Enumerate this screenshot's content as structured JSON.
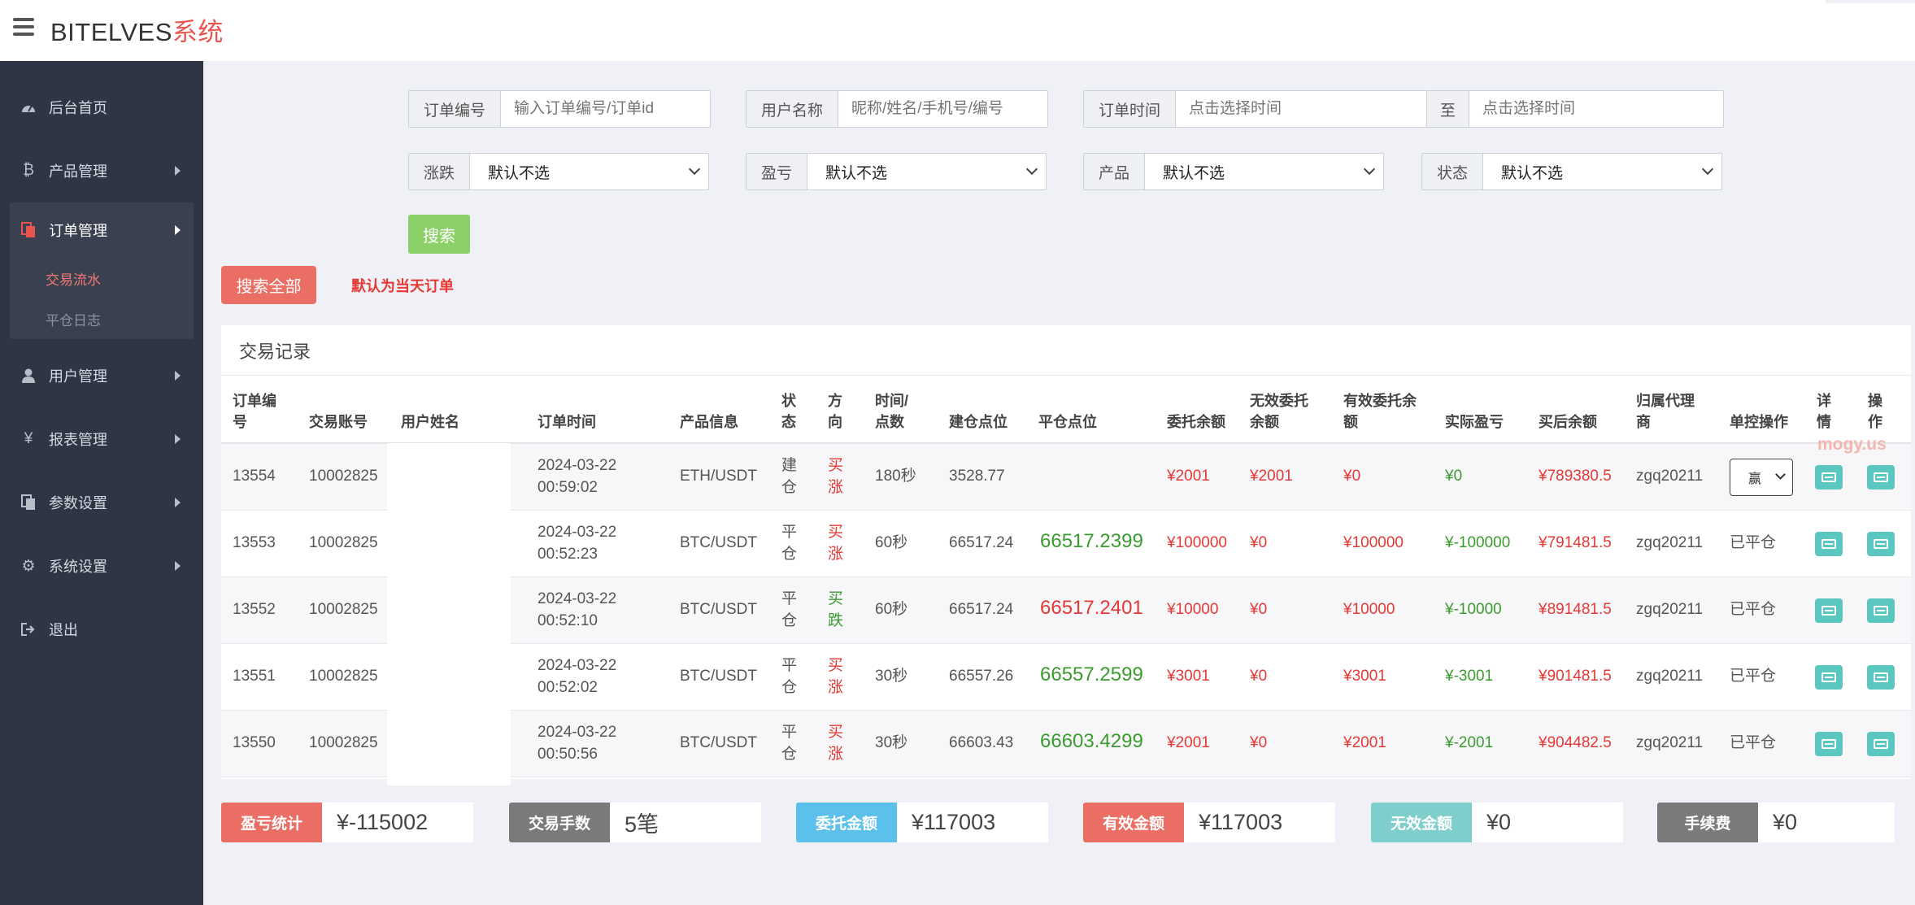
{
  "brand": {
    "prefix": "BITELVES",
    "suffix": "系统"
  },
  "sidebar": {
    "items": [
      {
        "label": "后台首页",
        "icon": "dashboard-icon"
      },
      {
        "label": "产品管理",
        "icon": "bitcoin-icon"
      },
      {
        "label": "订单管理",
        "icon": "copy-icon"
      },
      {
        "label": "用户管理",
        "icon": "user-icon"
      },
      {
        "label": "报表管理",
        "icon": "yen-icon"
      },
      {
        "label": "参数设置",
        "icon": "copy-icon"
      },
      {
        "label": "系统设置",
        "icon": "gears-icon"
      },
      {
        "label": "退出",
        "icon": "sign-out-icon"
      }
    ],
    "sub": [
      {
        "label": "交易流水"
      },
      {
        "label": "平仓日志"
      }
    ]
  },
  "filters": {
    "order_no": {
      "label": "订单编号",
      "placeholder": "输入订单编号/订单id"
    },
    "user": {
      "label": "用户名称",
      "placeholder": "昵称/姓名/手机号/编号"
    },
    "time": {
      "label": "订单时间",
      "placeholder": "点击选择时间"
    },
    "to": {
      "label": "至",
      "placeholder": "点击选择时间"
    },
    "updown": {
      "label": "涨跌",
      "value": "默认不选"
    },
    "profit": {
      "label": "盈亏",
      "value": "默认不选"
    },
    "product": {
      "label": "产品",
      "value": "默认不选"
    },
    "status": {
      "label": "状态",
      "value": "默认不选"
    },
    "search_button": "搜索",
    "search_all_button": "搜索全部",
    "note": "默认为当天订单"
  },
  "table": {
    "title": "交易记录",
    "headers": {
      "id": [
        "订单编",
        "号"
      ],
      "account": [
        "交易账号"
      ],
      "name": [
        "用户姓名"
      ],
      "time": [
        "订单时间"
      ],
      "product": [
        "产品信息"
      ],
      "status": [
        "状",
        "态"
      ],
      "dir": [
        "方",
        "向"
      ],
      "dur": [
        "时间/",
        "点数"
      ],
      "open": [
        "建仓点位"
      ],
      "close": [
        "平仓点位"
      ],
      "amount": [
        "委托余额"
      ],
      "invalid": [
        "无效委托",
        "余额"
      ],
      "valid": [
        "有效委托余",
        "额"
      ],
      "pnl": [
        "实际盈亏"
      ],
      "after": [
        "买后余额"
      ],
      "agent": [
        "归属代理",
        "商"
      ],
      "ctrl": [
        "单控操作"
      ],
      "detail": [
        "详",
        "情"
      ],
      "op": [
        "操",
        "作"
      ]
    },
    "rows": [
      {
        "id": "13554",
        "account": "10002825",
        "date": "2024-03-22",
        "time": "00:59:02",
        "product": "ETH/USDT",
        "status": [
          "建",
          "仓"
        ],
        "dir": [
          "买",
          "涨"
        ],
        "dir_color": "red",
        "dur": "180秒",
        "open": "3528.77",
        "close": "",
        "close_color": "",
        "amount": "¥2001",
        "invalid": "¥2001",
        "valid": "¥0",
        "pnl": "¥0",
        "after": "¥789380.5",
        "agent": "zgq20211",
        "ctrl": "",
        "ctrl_select": "赢"
      },
      {
        "id": "13553",
        "account": "10002825",
        "date": "2024-03-22",
        "time": "00:52:23",
        "product": "BTC/USDT",
        "status": [
          "平",
          "仓"
        ],
        "dir": [
          "买",
          "涨"
        ],
        "dir_color": "red",
        "dur": "60秒",
        "open": "66517.24",
        "close": "66517.2399",
        "close_color": "green",
        "amount": "¥100000",
        "invalid": "¥0",
        "valid": "¥100000",
        "pnl": "¥-100000",
        "after": "¥791481.5",
        "agent": "zgq20211",
        "ctrl": "已平仓",
        "ctrl_select": ""
      },
      {
        "id": "13552",
        "account": "10002825",
        "date": "2024-03-22",
        "time": "00:52:10",
        "product": "BTC/USDT",
        "status": [
          "平",
          "仓"
        ],
        "dir": [
          "买",
          "跌"
        ],
        "dir_color": "green",
        "dur": "60秒",
        "open": "66517.24",
        "close": "66517.2401",
        "close_color": "red",
        "amount": "¥10000",
        "invalid": "¥0",
        "valid": "¥10000",
        "pnl": "¥-10000",
        "after": "¥891481.5",
        "agent": "zgq20211",
        "ctrl": "已平仓",
        "ctrl_select": ""
      },
      {
        "id": "13551",
        "account": "10002825",
        "date": "2024-03-22",
        "time": "00:52:02",
        "product": "BTC/USDT",
        "status": [
          "平",
          "仓"
        ],
        "dir": [
          "买",
          "涨"
        ],
        "dir_color": "red",
        "dur": "30秒",
        "open": "66557.26",
        "close": "66557.2599",
        "close_color": "green",
        "amount": "¥3001",
        "invalid": "¥0",
        "valid": "¥3001",
        "pnl": "¥-3001",
        "after": "¥901481.5",
        "agent": "zgq20211",
        "ctrl": "已平仓",
        "ctrl_select": ""
      },
      {
        "id": "13550",
        "account": "10002825",
        "date": "2024-03-22",
        "time": "00:50:56",
        "product": "BTC/USDT",
        "status": [
          "平",
          "仓"
        ],
        "dir": [
          "买",
          "涨"
        ],
        "dir_color": "red",
        "dur": "30秒",
        "open": "66603.43",
        "close": "66603.4299",
        "close_color": "green",
        "amount": "¥2001",
        "invalid": "¥0",
        "valid": "¥2001",
        "pnl": "¥-2001",
        "after": "¥904482.5",
        "agent": "zgq20211",
        "ctrl": "已平仓",
        "ctrl_select": ""
      }
    ],
    "watermark": "mogy.us"
  },
  "stats": [
    {
      "label": "盈亏统计",
      "value": "¥-115002",
      "color": "#ea6e63"
    },
    {
      "label": "交易手数",
      "value": "5笔",
      "color": "#7a7a7a"
    },
    {
      "label": "委托金额",
      "value": "¥117003",
      "color": "#5bc0eb"
    },
    {
      "label": "有效金额",
      "value": "¥117003",
      "color": "#ea6e63"
    },
    {
      "label": "无效金额",
      "value": "¥0",
      "color": "#7ecfcb"
    },
    {
      "label": "手续费",
      "value": "¥0",
      "color": "#7a7a7a"
    }
  ]
}
